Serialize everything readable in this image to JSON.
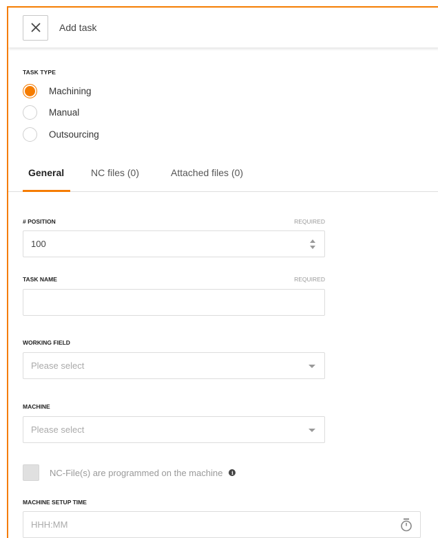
{
  "header": {
    "title": "Add task"
  },
  "task_type": {
    "label": "TASK TYPE",
    "options": [
      {
        "label": "Machining",
        "checked": true
      },
      {
        "label": "Manual",
        "checked": false
      },
      {
        "label": "Outsourcing",
        "checked": false
      }
    ]
  },
  "tabs": [
    {
      "label": "General",
      "active": true
    },
    {
      "label": "NC files (0)",
      "active": false
    },
    {
      "label": "Attached files (0)",
      "active": false
    }
  ],
  "form": {
    "position": {
      "label": "# POSITION",
      "required": "REQUIRED",
      "value": "100"
    },
    "task_name": {
      "label": "TASK NAME",
      "required": "REQUIRED",
      "value": ""
    },
    "working_field": {
      "label": "WORKING FIELD",
      "placeholder": "Please select"
    },
    "machine": {
      "label": "MACHINE",
      "placeholder": "Please select"
    },
    "nc_programmed": {
      "label": "NC-File(s) are programmed on the machine",
      "checked": false
    },
    "setup_time": {
      "label": "MACHINE SETUP TIME",
      "placeholder": "HHH:MM"
    }
  },
  "colors": {
    "accent": "#f57c00"
  }
}
